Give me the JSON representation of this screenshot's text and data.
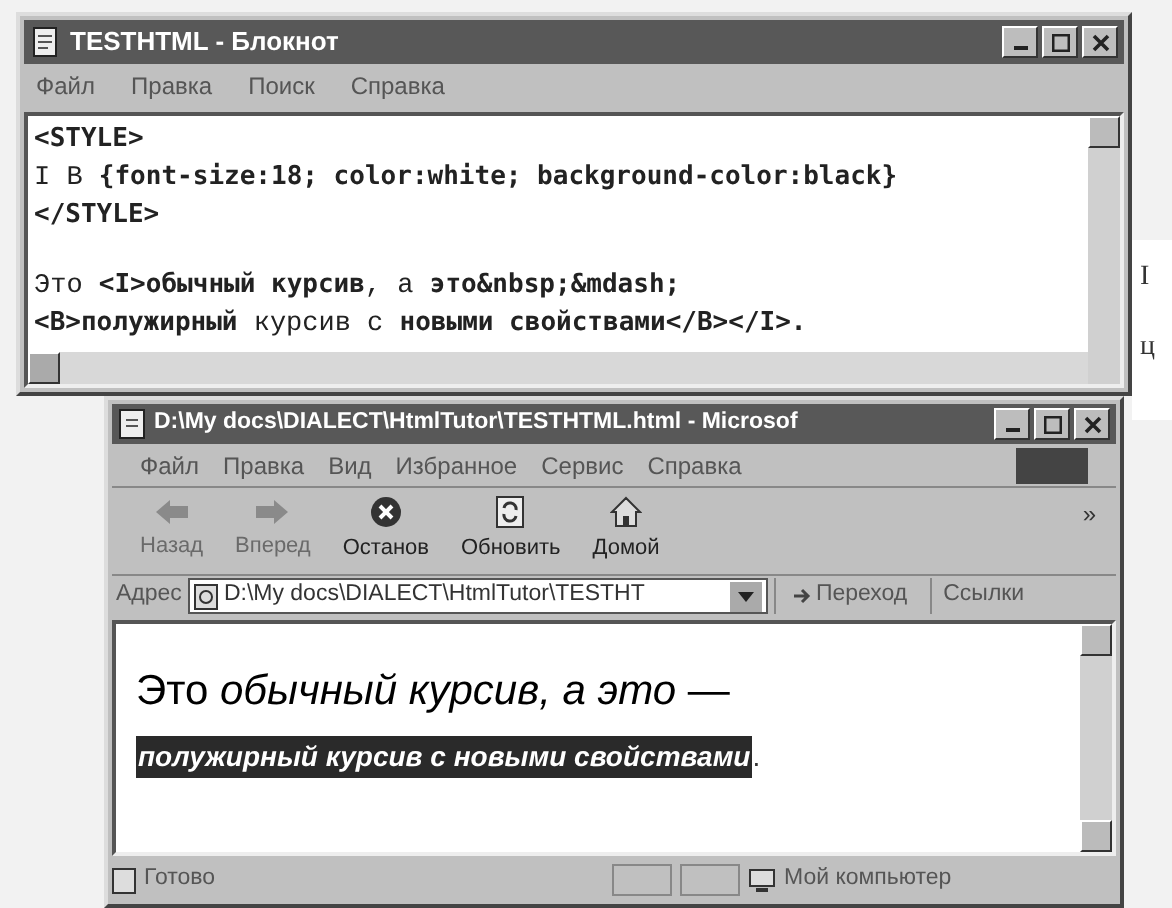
{
  "background_window": {
    "lines": [
      "I",
      "ц"
    ]
  },
  "notepad": {
    "title": "TESTHTML - Блокнот",
    "menu": [
      "Файл",
      "Правка",
      "Поиск",
      "Справка"
    ],
    "blocks": [
      [
        "**<STYLE>**",
        "I B **{font-size:18; color:white; background-color:black}**",
        "**</STYLE>**"
      ],
      [
        "Это **<I>обычный курсив**, а **это&nbsp;&mdash;**",
        "**<B>полужирный** курсив с **новыми свойствами</B></I>.**"
      ]
    ]
  },
  "browser": {
    "title": "D:\\My docs\\DIALECT\\HtmlTutor\\TESTHTML.html - Microsof",
    "menu": [
      "Файл",
      "Правка",
      "Вид",
      "Избранное",
      "Сервис",
      "Справка"
    ],
    "toolbar": [
      {
        "kind": "back",
        "label": "Назад",
        "disabled": true
      },
      {
        "kind": "forward",
        "label": "Вперед",
        "disabled": true
      },
      {
        "kind": "stop",
        "label": "Останов",
        "disabled": false
      },
      {
        "kind": "refresh",
        "label": "Обновить",
        "disabled": false
      },
      {
        "kind": "home",
        "label": "Домой",
        "disabled": false
      }
    ],
    "toolbar_more": "»",
    "address": {
      "label": "Адрес",
      "value": "D:\\My docs\\DIALECT\\HtmlTutor\\TESTHT",
      "go": "Переход",
      "links": "Ссылки"
    },
    "content": {
      "line1": "Это *обычный курсив, а это* —",
      "highlight": "полужирный курсив с новыми свойствами",
      "after": "."
    },
    "status": {
      "text": "Готово",
      "zone": "Мой компьютер"
    }
  }
}
